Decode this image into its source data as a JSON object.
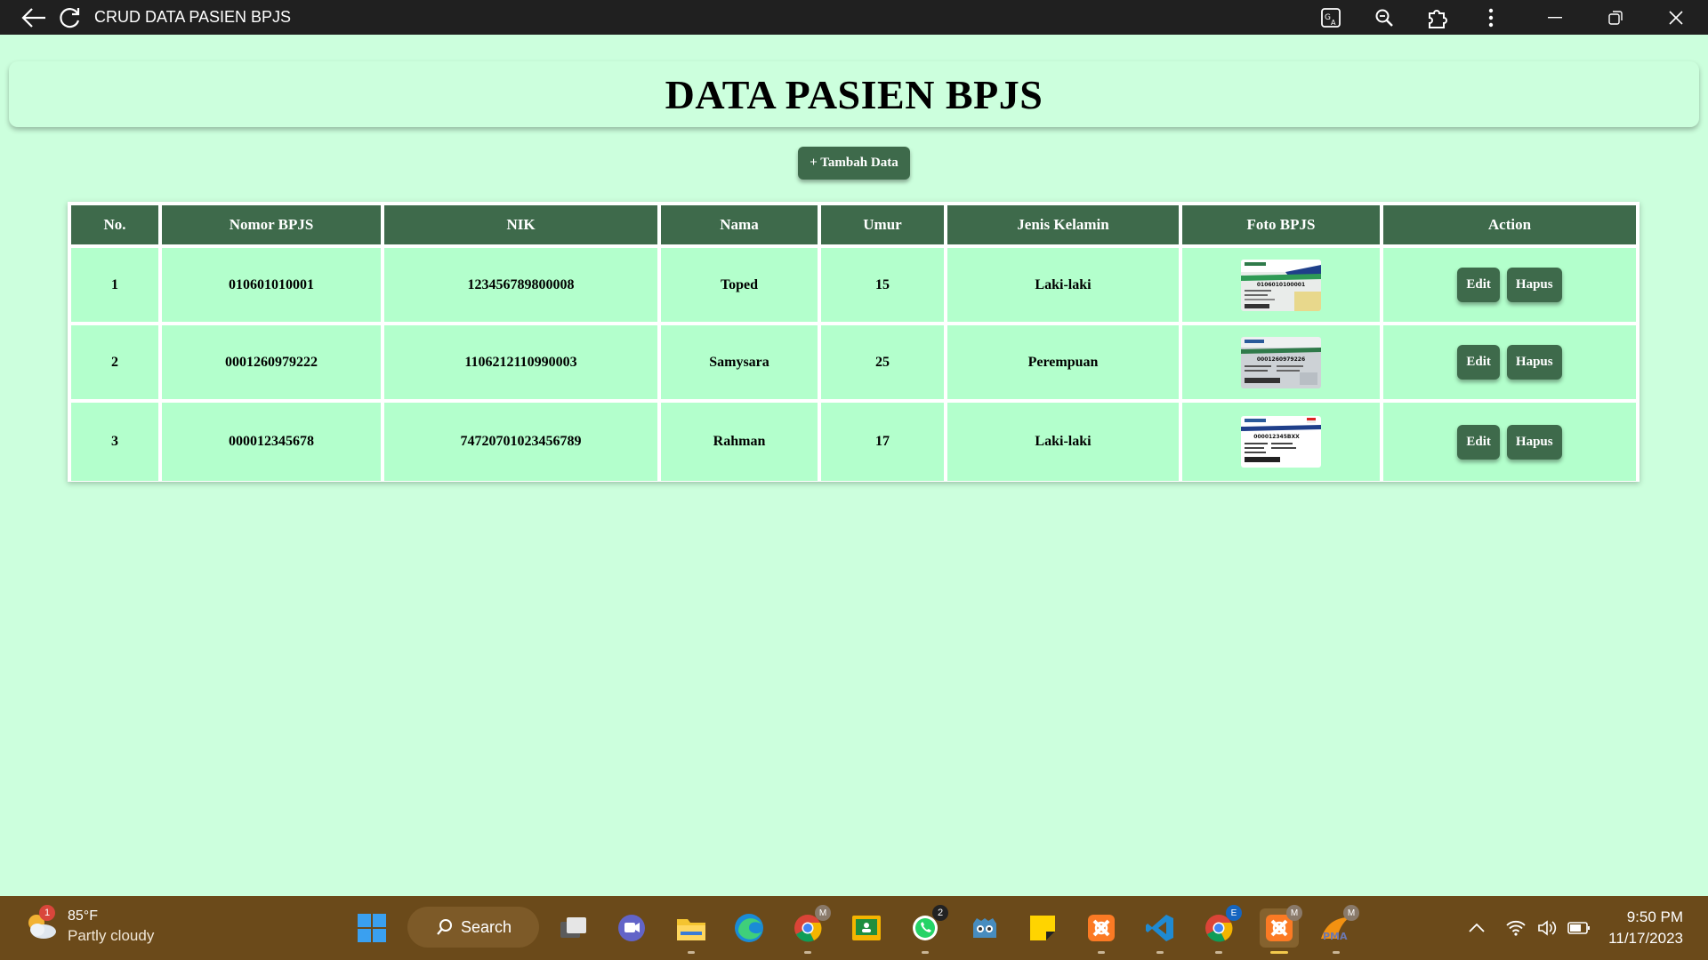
{
  "titlebar": {
    "title": "CRUD DATA PASIEN BPJS",
    "icons": [
      "back-icon",
      "reload-icon",
      "translate-icon",
      "zoom-icon",
      "extensions-icon",
      "more-icon",
      "minimize-icon",
      "restore-icon",
      "close-icon"
    ]
  },
  "page": {
    "heading": "DATA PASIEN BPJS",
    "add_button": "+ Tambah Data"
  },
  "table": {
    "headers": [
      "No.",
      "Nomor BPJS",
      "NIK",
      "Nama",
      "Umur",
      "Jenis Kelamin",
      "Foto BPJS",
      "Action"
    ],
    "rows": [
      {
        "no": "1",
        "bpjs": "010601010001",
        "nik": "123456789800008",
        "nama": "Toped",
        "umur": "15",
        "jk": "Laki-laki",
        "edit": "Edit",
        "hapus": "Hapus"
      },
      {
        "no": "2",
        "bpjs": "0001260979222",
        "nik": "1106212110990003",
        "nama": "Samysara",
        "umur": "25",
        "jk": "Perempuan",
        "edit": "Edit",
        "hapus": "Hapus"
      },
      {
        "no": "3",
        "bpjs": "000012345678",
        "nik": "74720701023456789",
        "nama": "Rahman",
        "umur": "17",
        "jk": "Laki-laki",
        "edit": "Edit",
        "hapus": "Hapus"
      }
    ],
    "card_numbers": [
      "0106010100001",
      "0001260979226",
      "000012345BXX"
    ]
  },
  "taskbar": {
    "weather_temp": "85°F",
    "weather_cond": "Partly cloudy",
    "weather_badge": "1",
    "search_label": "Search",
    "whatsapp_badge": "2",
    "time": "9:50 PM",
    "date": "11/17/2023"
  },
  "colors": {
    "page_bg": "#ccffdd",
    "header_cell": "#3e6a4b",
    "row_cell": "#b3ffcc",
    "taskbar": "#6b4a1a"
  }
}
